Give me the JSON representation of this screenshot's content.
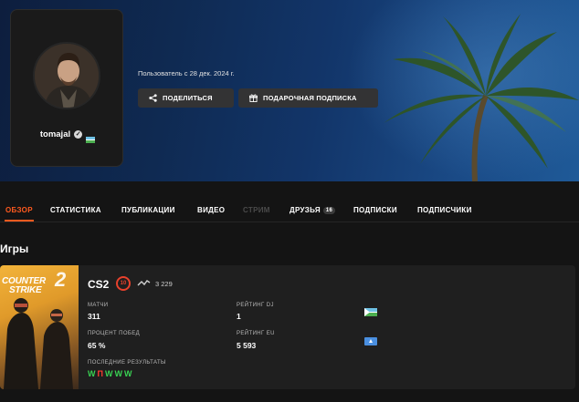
{
  "profile": {
    "username": "tomajal",
    "member_since": "Пользователь с 28 дек. 2024 г.",
    "share_label": "ПОДЕЛИТЬСЯ",
    "gift_label": "ПОДАРОЧНАЯ ПОДПИСКА"
  },
  "tabs": [
    {
      "label": "ОБЗОР",
      "state": "active"
    },
    {
      "label": "СТАТИСТИКА",
      "state": "normal"
    },
    {
      "label": "ПУБЛИКАЦИИ",
      "state": "normal"
    },
    {
      "label": "ВИДЕО",
      "state": "normal"
    },
    {
      "label": "СТРИМ",
      "state": "disabled"
    },
    {
      "label": "ДРУЗЬЯ",
      "badge": "16",
      "state": "normal"
    },
    {
      "label": "ПОДПИСКИ",
      "state": "normal"
    },
    {
      "label": "ПОДПИСЧИКИ",
      "state": "normal"
    }
  ],
  "games_section": {
    "title": "Игры"
  },
  "game": {
    "cover_line1": "COUNTER",
    "cover_line2": "STRIKE",
    "cover_number": "2",
    "name": "CS2",
    "level": "10",
    "elo": "3 229",
    "stats": {
      "matches_label": "МАТЧИ",
      "matches_value": "311",
      "rank_dj_label": "РЕЙТИНГ DJ",
      "rank_dj_value": "1",
      "winrate_label": "ПРОЦЕНТ ПОБЕД",
      "winrate_value": "65 %",
      "rank_eu_label": "РЕЙТИНГ EU",
      "rank_eu_value": "5 593",
      "recent_label": "ПОСЛЕДНИЕ РЕЗУЛЬТАТЫ"
    },
    "recent_results": [
      "W",
      "П",
      "W",
      "W",
      "W"
    ]
  },
  "colors": {
    "accent": "#ff5a1f",
    "win": "#39d353",
    "loss": "#ff3b30",
    "level": "#e8412c"
  },
  "icons": {
    "share": "share-icon",
    "gift": "gift-icon",
    "verified": "verified-icon",
    "elo": "elo-trend-icon"
  }
}
